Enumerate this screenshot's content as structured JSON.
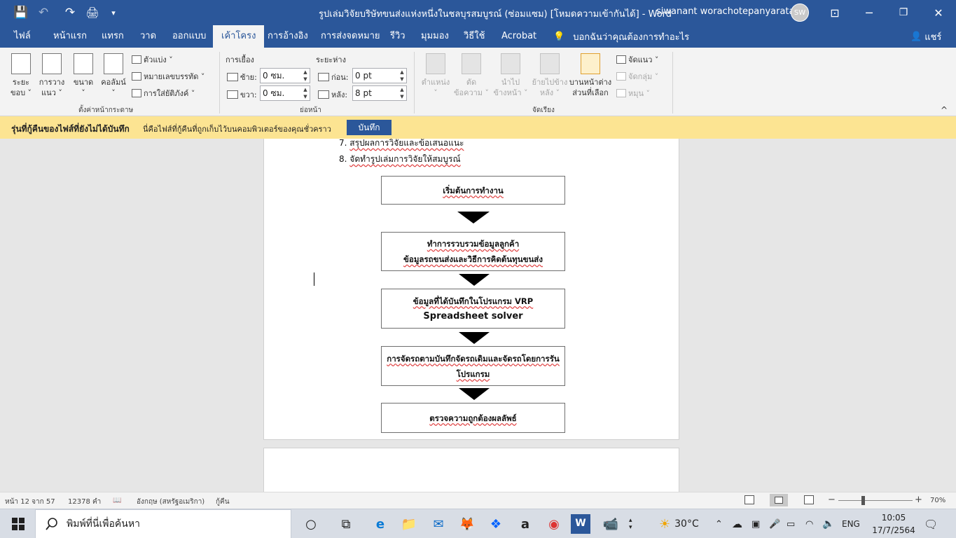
{
  "titlebar": {
    "doc_title": "รูปเล่มวิจัยบริษัทขนส่งแห่งหนึ่งในชลบุรสมบูรณ์ (ซ่อมแซม) [โหมดความเข้ากันได้]  -  Word",
    "user": "siwanant worachotepanyaratana",
    "initials": "SW",
    "qat": {
      "save": "💾",
      "undo": "↶",
      "redo": "↷",
      "print": "🖨",
      "more": "▾"
    },
    "win": {
      "ribbon_opt": "⊡",
      "min": "─",
      "max": "❐",
      "close": "✕"
    }
  },
  "tabs": [
    "ไฟล์",
    "หน้าแรก",
    "แทรก",
    "วาด",
    "ออกแบบ",
    "เค้าโครง",
    "การอ้างอิง",
    "การส่งจดหมาย",
    "รีวิว",
    "มุมมอง",
    "วิธีใช้",
    "Acrobat"
  ],
  "active_tab": "เค้าโครง",
  "tell_me": {
    "icon": "💡",
    "text": "บอกฉันว่าคุณต้องการทำอะไร"
  },
  "share": {
    "icon": "👤",
    "label": "แชร์"
  },
  "ribbon": {
    "page_setup": {
      "margins": "ระยะ\nขอบ ˅",
      "orientation": "การวาง\nแนว ˅",
      "size": "ขนาด\n˅",
      "columns": "คอลัมน์\n˅",
      "breaks": "ตัวแบ่ง ˅",
      "line_numbers": "หมายเลขบรรทัด ˅",
      "hyphenation": "การใส่ยัติภังค์ ˅",
      "group": "ตั้งค่าหน้ากระดาษ"
    },
    "paragraph": {
      "indent": "การเยื้อง",
      "spacing": "ระยะห่าง",
      "left_label": "ซ้าย:",
      "left_value": "0 ซม.",
      "right_label": "ขวา:",
      "right_value": "0 ซม.",
      "before_label": "ก่อน:",
      "before_value": "0 pt",
      "after_label": "หลัง:",
      "after_value": "8 pt",
      "group": "ย่อหน้า"
    },
    "arrange": {
      "position": "ตำแหน่ง\n˅",
      "wrap": "ตัด\nข้อความ ˅",
      "forward": "นำไป\nข้างหน้า ˅",
      "backward": "ย้ายไปข้าง\nหลัง ˅",
      "selection_pane": "บานหน้าต่าง\nส่วนที่เลือก",
      "align": "จัดแนว ˅",
      "group_btn": "จัดกลุ่ม ˅",
      "rotate": "หมุน ˅",
      "group": "จัดเรียง"
    },
    "collapse": "^"
  },
  "message_bar": {
    "title": "รุ่นที่กู้คืนของไฟส์ที่ยังไม่ได้บันทึก",
    "text": "นี่คือไฟส์ที่กู้คืนที่ถูกเก็บไว้บนคอมพิวเตอร์ของคุณชั่วคราว",
    "button": "บันทึก"
  },
  "document": {
    "list": [
      {
        "num": "7.",
        "text": "สรุปผลการวิจัยและข้อเสนอแนะ"
      },
      {
        "num": "8.",
        "text": "จัดทำรูปเล่มการวิจัยให้สมบูรณ์"
      }
    ],
    "flowchart": [
      {
        "lines": [
          "เริ่มต้นการทำงาน"
        ]
      },
      {
        "lines": [
          "ทำการรวบรวมข้อมูลลูกค้า",
          "ข้อมูลรถขนส่งและวิธีการคิดต้นทุนขนส่ง"
        ]
      },
      {
        "lines": [
          "ข้อมูลที่ได้บันทึกในโปรแกรม VRP",
          "Spreadsheet solver"
        ]
      },
      {
        "lines": [
          "การจัดรถตามบันทึกจัดรถเดิมและจัดรถโดยการรัน",
          "โปรแกรม"
        ]
      },
      {
        "lines": [
          "ตรวจความถูกต้องผลลัพธ์"
        ]
      }
    ]
  },
  "status": {
    "page": "หน้า 12 จาก 57",
    "words": "12378 คำ",
    "proof_icon": "📖",
    "lang": "อังกฤษ (สหรัฐอเมริกา)",
    "recovered": "กู้คืน",
    "zoom_minus": "−",
    "zoom_plus": "+",
    "zoom": "70%"
  },
  "taskbar": {
    "search": "พิมพ์ที่นี่เพื่อค้นหา",
    "temp": "30°C",
    "lang": "ENG",
    "time": "10:05",
    "date": "17/7/2564",
    "apps": [
      "○",
      "⧉",
      "e",
      "📁",
      "✉",
      "🦊",
      "❖",
      "a",
      "◉",
      "W",
      "📹"
    ]
  }
}
